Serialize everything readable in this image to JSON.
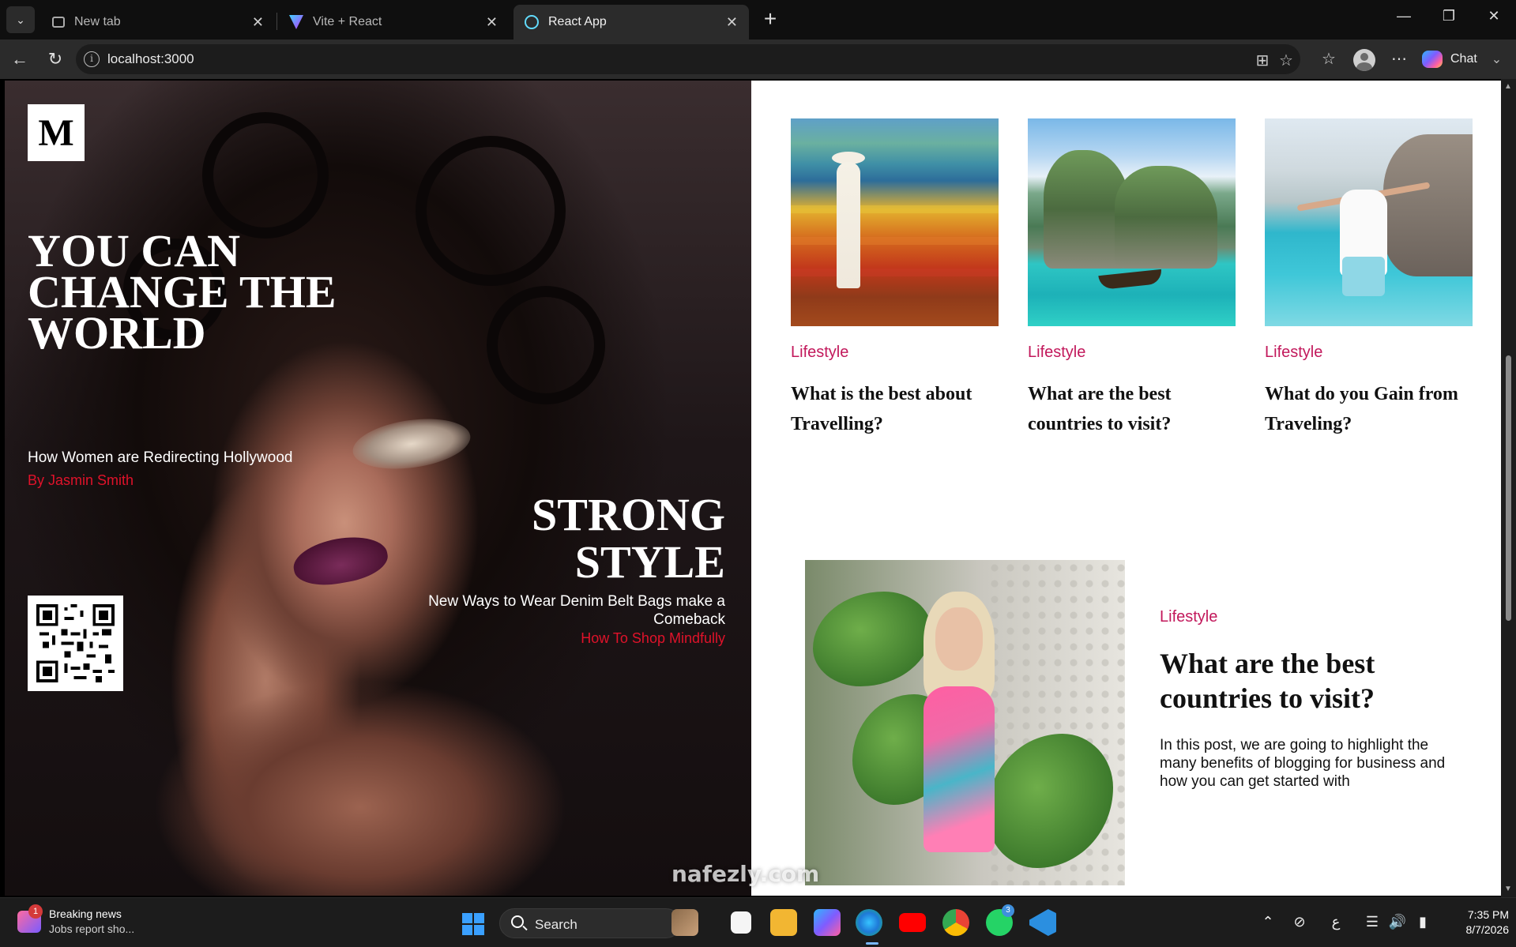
{
  "browser": {
    "tabs": [
      {
        "title": "New tab",
        "active": false
      },
      {
        "title": "Vite + React",
        "active": false
      },
      {
        "title": "React App",
        "active": true
      }
    ],
    "url": "localhost:3000",
    "chat_label": "Chat"
  },
  "hero": {
    "logo_letter": "M",
    "headline": "YOU CAN CHANGE THE WORLD",
    "subtitle": "How Women are Redirecting Hollywood",
    "author": "By Jasmin Smith",
    "second_headline": "STRONG STYLE",
    "second_subtitle": "New Ways to Wear Denim Belt Bags make a Comeback",
    "second_link": "How To Shop Mindfully"
  },
  "cards": [
    {
      "category": "Lifestyle",
      "title": "What is the best about Travelling?"
    },
    {
      "category": "Lifestyle",
      "title": "What are the best countries to visit?"
    },
    {
      "category": "Lifestyle",
      "title": "What do you Gain from Traveling?"
    }
  ],
  "feature": {
    "category": "Lifestyle",
    "title": "What are the best countries to visit?",
    "text": "In this post, we are going to highlight the many benefits of blogging for business and how you can get started with"
  },
  "taskbar": {
    "news_badge": "1",
    "news_title": "Breaking news",
    "news_sub": "Jobs report sho...",
    "search_label": "Search",
    "whatsapp_badge": "3",
    "lang": "ع",
    "time": "7:35 PM",
    "date": "8/7/2026"
  },
  "watermark": "nafezly.com",
  "colors": {
    "accent_red": "#e0122a",
    "category_pink": "#c2185b",
    "tab_active": "#2b2b2b"
  }
}
